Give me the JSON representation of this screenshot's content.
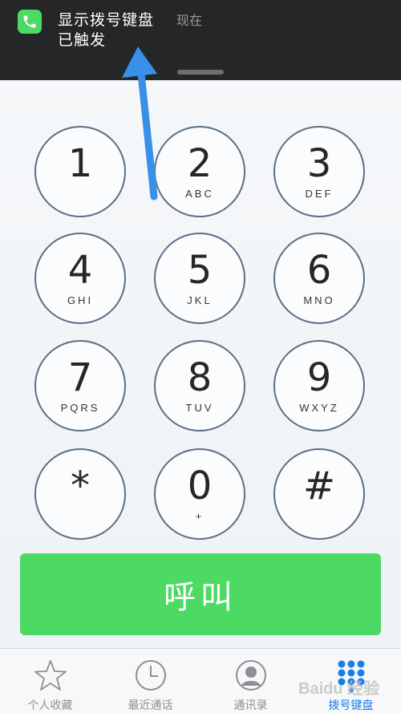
{
  "notification": {
    "title": "显示拨号键盘",
    "time": "现在",
    "subtitle": "已触发",
    "app_icon": "phone-icon"
  },
  "keypad": {
    "keys": [
      {
        "digit": "1",
        "letters": ""
      },
      {
        "digit": "2",
        "letters": "ABC"
      },
      {
        "digit": "3",
        "letters": "DEF"
      },
      {
        "digit": "4",
        "letters": "GHI"
      },
      {
        "digit": "5",
        "letters": "JKL"
      },
      {
        "digit": "6",
        "letters": "MNO"
      },
      {
        "digit": "7",
        "letters": "PQRS"
      },
      {
        "digit": "8",
        "letters": "TUV"
      },
      {
        "digit": "9",
        "letters": "WXYZ"
      },
      {
        "digit": "*",
        "letters": ""
      },
      {
        "digit": "0",
        "letters": "+"
      },
      {
        "digit": "#",
        "letters": ""
      }
    ]
  },
  "call_button": {
    "label": "呼叫",
    "color": "#4cd964"
  },
  "tabbar": {
    "tabs": [
      {
        "label": "个人收藏",
        "icon": "star-icon",
        "active": false
      },
      {
        "label": "最近通话",
        "icon": "clock-icon",
        "active": false
      },
      {
        "label": "通讯录",
        "icon": "contact-icon",
        "active": false
      },
      {
        "label": "拨号键盘",
        "icon": "keypad-icon",
        "active": true
      }
    ],
    "active_color": "#1a7ee8"
  },
  "watermark": "Baidu 经验",
  "colors": {
    "banner_bg": "#252627",
    "annotation_arrow": "#3a8fe8"
  }
}
